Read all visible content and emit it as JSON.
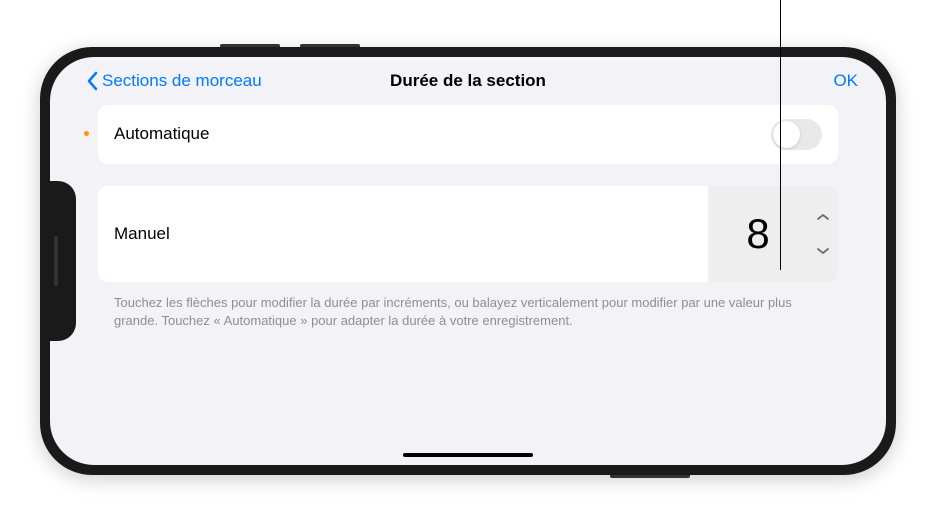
{
  "header": {
    "back_label": "Sections de morceau",
    "title": "Durée de la section",
    "ok_label": "OK"
  },
  "rows": {
    "automatic": {
      "label": "Automatique"
    },
    "manual": {
      "label": "Manuel",
      "value": "8"
    }
  },
  "help_text": "Touchez les flèches pour modifier la durée par incréments, ou balayez verticalement pour modifier par une valeur plus grande. Touchez « Automatique » pour adapter la durée à votre enregistrement."
}
